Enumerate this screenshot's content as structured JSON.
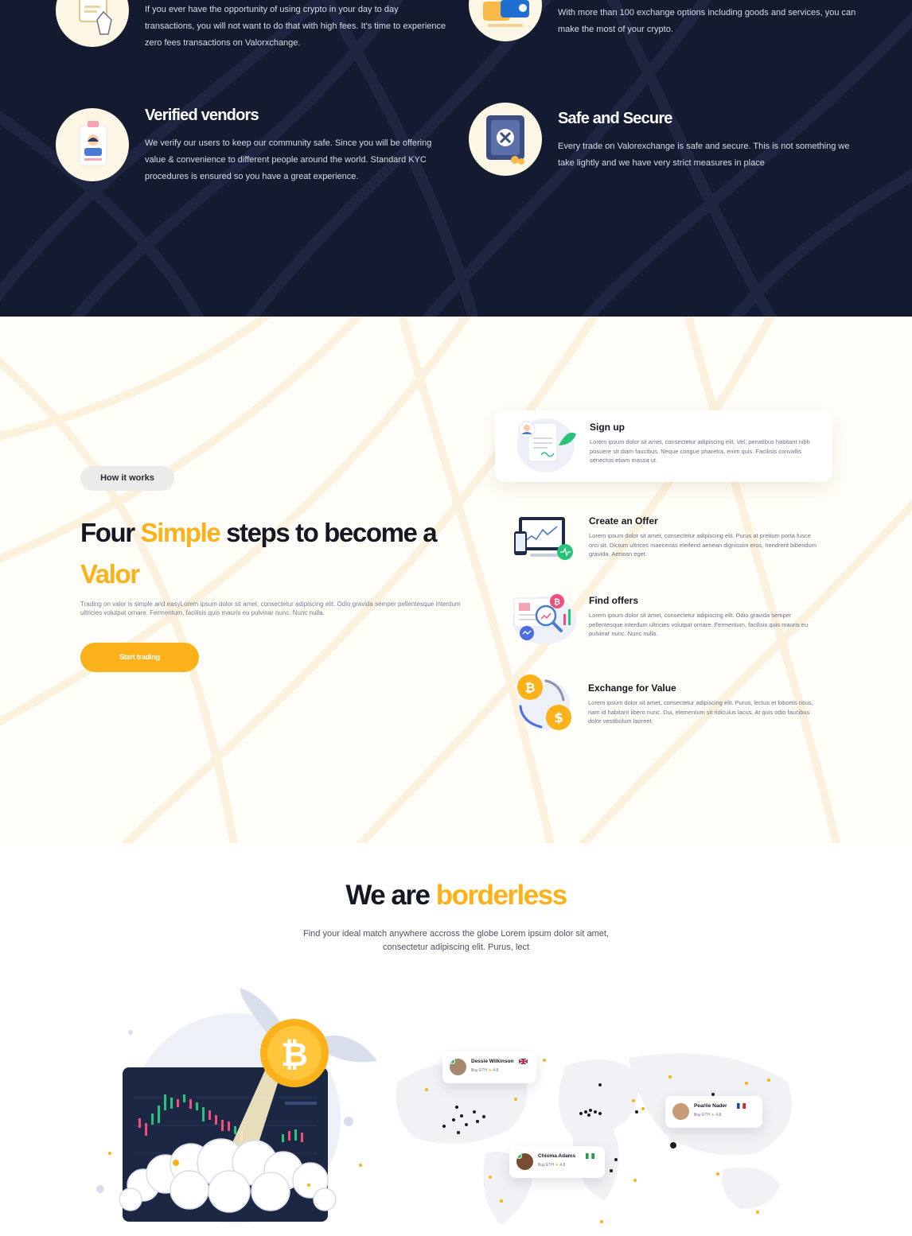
{
  "colors": {
    "accent": "#fbb11a",
    "dark_bg": "#141b31",
    "text_dark": "#141823",
    "feature_icon_bg": "#fdf6e4"
  },
  "features": [
    {
      "title": "",
      "icon": "hand-tap-icon",
      "text": "If you ever have the opportunity of using crypto in your day to day transactions, you will not want to do that with high fees. It's time to experience zero fees transactions on Valorxchange."
    },
    {
      "title": "",
      "icon": "exchange-chat-icon",
      "text": "With more than 100 exchange options including goods and services, you can make the most of your crypto."
    },
    {
      "title": "Verified vendors",
      "icon": "id-badge-icon",
      "text": "We verify our users to keep our community safe. Since you will be offering value & convenience to different people around the world. Standard KYC procedures is ensured so you have a great experience."
    },
    {
      "title": "Safe and Secure",
      "icon": "vault-icon",
      "text": "Every trade on Valorexchange is safe and secure. This is not something we take lightly and we have very strict measures in place"
    }
  ],
  "how": {
    "pill": "How it works",
    "title_pre": "Four ",
    "title_accent_1": "Simple",
    "title_mid": " steps to become a",
    "title_accent_2": "Valor",
    "description": "Trading on valor is simple and easyLorem ipsum dolor sit amet, consectetur adipiscing elit. Odio gravida semper pellentesque interdum ultricies volutpat ornare. Fermentum, facilisis quis mauris eu pulvinar nunc. Nunc nulla.",
    "cta": "Start trading",
    "steps": [
      {
        "title": "Sign up",
        "icon": "signup-document-icon",
        "text": "Lorem ipsum dolor sit amet, consectetur adipiscing elit. Vel, penatibus habitant nibh posuere sit diam faucibus. Neque congue pharetra, enim quis. Facilisis convallis senectus etiam massa ut."
      },
      {
        "title": "Create an Offer",
        "icon": "offer-devices-icon",
        "text": "Lorem ipsum dolor sit amet, consectetur adipiscing elit. Purus at pretium porta fusce orci sit. Dictum ultrices maecenas eleifend aenean dignissim eros, hendrerit bibendum gravida. Aenean eget."
      },
      {
        "title": "Find offers",
        "icon": "search-chart-icon",
        "text": "Lorem ipsum dolor sit amet, consectetur adipiscing elit. Odio gravida semper pellentesque interdum ultricies volutpat ornare. Fermentum, facilisis quis mauris eu pulvinar nunc. Nunc nulla."
      },
      {
        "title": "Exchange for Value",
        "icon": "bitcoin-dollar-exchange-icon",
        "text": "Lorem ipsum dolor sit amet, consectetur adipiscing elit. Purus, lectus et lobortis risus, nam id habitant libero nunc. Dui, elementum sit ridiculus lacus. At quis odio faucibus dolor vestibulum laoreet."
      }
    ]
  },
  "borderless": {
    "title_pre": "We are ",
    "title_accent": "borderless",
    "description": "Find your ideal match anywhere accross the globe Lorem ipsum dolor sit amet, consectetur adipiscing elit. Purus, lect",
    "users": [
      {
        "name": "Dessie Wilkinson",
        "meta": "Buy ETH",
        "rating": "4.8",
        "flag": "uk-flag-icon"
      },
      {
        "name": "Pearlie Nader",
        "meta": "Buy ETH",
        "rating": "4.8",
        "flag": "france-flag-icon"
      },
      {
        "name": "Chioma Adams",
        "meta": "Buy ETH",
        "rating": "4.8",
        "flag": "nigeria-flag-icon"
      }
    ]
  }
}
